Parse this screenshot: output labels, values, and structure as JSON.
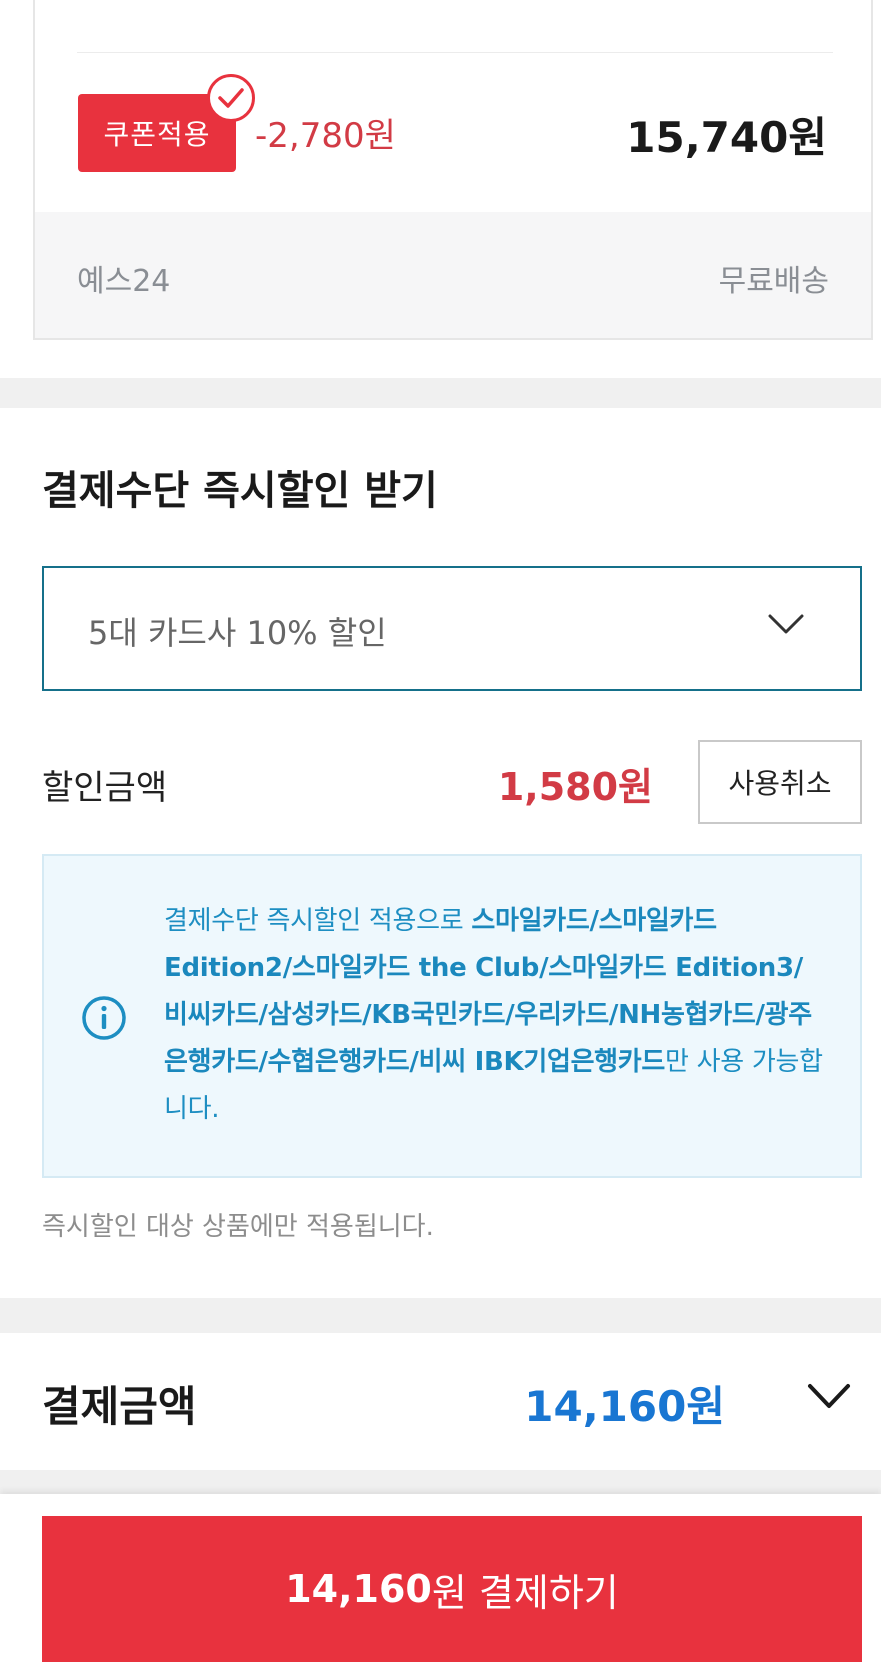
{
  "product_card": {
    "coupon_badge_label": "쿠폰적용",
    "coupon_discount": "-2,780원",
    "item_price": "15,740원",
    "seller": "예스24",
    "shipping": "무료배송"
  },
  "instant_discount": {
    "title": "결제수단 즉시할인 받기",
    "selected_option": "5대 카드사 10% 할인",
    "discount_label": "할인금액",
    "discount_amount": "1,580원",
    "cancel_button_label": "사용취소",
    "notice": {
      "prefix": "결제수단 즉시할인 적용으로 ",
      "cards": "스마일카드/스마일카드 Edition2/스마일카드 the Club/스마일카드 Edition3/비씨카드/삼성카드/KB국민카드/우리카드/NH농협카드/광주은행카드/수협은행카드/비씨 IBK기업은행카드",
      "suffix": "만 사용 가능합니다."
    },
    "footnote": "즉시할인 대상 상품에만 적용됩니다."
  },
  "payment_total": {
    "label": "결제금액",
    "amount": "14,160원"
  },
  "pay_button": {
    "amount": "14,160",
    "label": "원 결제하기"
  },
  "colors": {
    "accent_red": "#e8323e",
    "price_blue": "#1976d2",
    "select_border": "#15708a",
    "notice_text": "#1d8ec2"
  },
  "icons": [
    "check-circle-icon",
    "chevron-down-icon",
    "info-circle-icon"
  ]
}
